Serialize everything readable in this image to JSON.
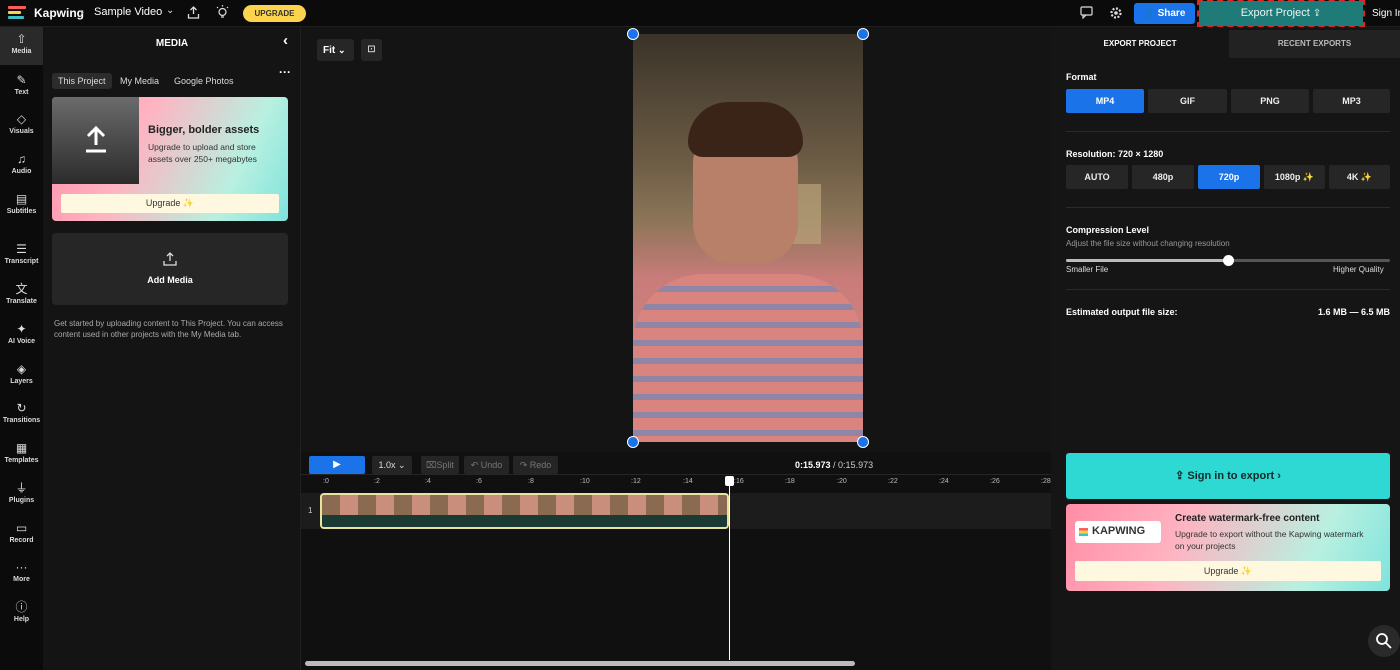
{
  "topbar": {
    "app_name": "Kapwing",
    "project_name": "Sample Video",
    "upgrade_label": "UPGRADE",
    "share_label": "Share",
    "export_label": "Export Project",
    "signin_label": "Sign In"
  },
  "rail": {
    "items": [
      {
        "label": "Media",
        "icon": "upload-icon"
      },
      {
        "label": "Text",
        "icon": "text-icon"
      },
      {
        "label": "Visuals",
        "icon": "shapes-icon"
      },
      {
        "label": "Audio",
        "icon": "music-note-icon"
      },
      {
        "label": "Subtitles",
        "icon": "subtitles-icon"
      },
      {
        "label": "Transcript",
        "icon": "transcript-icon"
      },
      {
        "label": "Translate",
        "icon": "translate-icon"
      },
      {
        "label": "AI Voice",
        "icon": "ai-voice-icon"
      },
      {
        "label": "Layers",
        "icon": "layers-icon"
      },
      {
        "label": "Transitions",
        "icon": "transitions-icon"
      },
      {
        "label": "Templates",
        "icon": "templates-icon"
      },
      {
        "label": "Plugins",
        "icon": "plug-icon"
      },
      {
        "label": "Record",
        "icon": "record-icon"
      },
      {
        "label": "More",
        "icon": "more-icon"
      },
      {
        "label": "Help",
        "icon": "help-icon"
      }
    ]
  },
  "media": {
    "title": "MEDIA",
    "tabs": [
      "This Project",
      "My Media",
      "Google Photos"
    ],
    "promo_title": "Bigger, bolder assets",
    "promo_text": "Upgrade to upload and store assets over 250+ megabytes",
    "promo_button": "Upgrade ✨",
    "add_media": "Add Media",
    "help_text": "Get started by uploading content to This Project. You can access content used in other projects with the My Media tab."
  },
  "stage": {
    "fit_label": "Fit"
  },
  "timeline": {
    "speed": "1.0x",
    "split": "Split",
    "undo": "Undo",
    "redo": "Redo",
    "current_time": "0:15.973",
    "total_time": "0:15.973",
    "ticks": [
      ":0",
      ":2",
      ":4",
      ":6",
      ":8",
      ":10",
      ":12",
      ":14",
      ":16",
      ":18",
      ":20",
      ":22",
      ":24",
      ":26",
      ":28"
    ],
    "track_number": "1"
  },
  "export": {
    "tab_export": "EXPORT PROJECT",
    "tab_recent": "RECENT EXPORTS",
    "format_label": "Format",
    "formats": [
      "MP4",
      "GIF",
      "PNG",
      "MP3"
    ],
    "selected_format": "MP4",
    "resolution_label": "Resolution:",
    "resolution_value": "720 × 1280",
    "resolutions": [
      "AUTO",
      "480p",
      "720p",
      "1080p ✨",
      "4K ✨"
    ],
    "selected_resolution": "720p",
    "compression_label": "Compression Level",
    "compression_sub": "Adjust the file size without changing resolution",
    "smaller_file": "Smaller File",
    "higher_quality": "Higher Quality",
    "compression_level": 0.5,
    "estimated_label": "Estimated output file size:",
    "estimated_value": "1.6 MB — 6.5 MB",
    "signin_export": "Sign in to export",
    "wm_title": "Create watermark-free content",
    "wm_text": "Upgrade to export without the Kapwing watermark on your projects",
    "wm_logo": "KAPWING",
    "wm_button": "Upgrade ✨"
  },
  "colors": {
    "accent_blue": "#1a73e8",
    "export_teal": "#1e7b78",
    "signin_cyan": "#2ed8d3",
    "upgrade_yellow": "#fcd34d"
  }
}
